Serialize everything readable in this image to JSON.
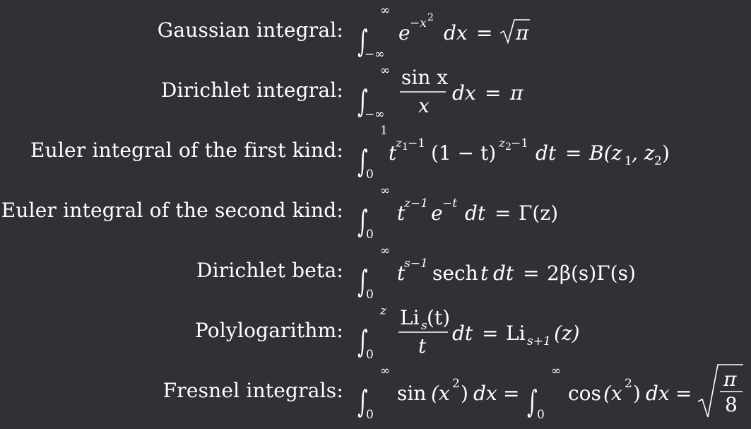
{
  "rows": [
    {
      "label": "Gaussian integral:",
      "formula": {
        "lower": "−∞",
        "upper": "∞",
        "base": "e",
        "sup": "−x",
        "supsup": "2",
        "d": "dx",
        "eq": "=",
        "root_arg": "π"
      }
    },
    {
      "label": "Dirichlet integral:",
      "formula": {
        "lower": "−∞",
        "upper": "∞",
        "numer": "sin x",
        "denom": "x",
        "d": "dx",
        "eq": "=",
        "rhs": "π"
      }
    },
    {
      "label": "Euler integral of the first kind:",
      "formula": {
        "lower": "0",
        "upper": "1",
        "t1": "t",
        "e1": "z",
        "e1s": "1",
        "e1r": "−1",
        "mid": "(1 − t)",
        "e2": "z",
        "e2s": "2",
        "e2r": "−1",
        "d": "dt",
        "eq": "=",
        "rhs": "B(z",
        "rhs_s1": "1",
        "rhs_mid": ", z",
        "rhs_s2": "2",
        "rhs_end": ")"
      }
    },
    {
      "label": "Euler integral of the second kind:",
      "formula": {
        "lower": "0",
        "upper": "∞",
        "t1": "t",
        "e1": "z−1",
        "e": "e",
        "e2": "−t",
        "d": "dt",
        "eq": "=",
        "rhs": "Γ(z)"
      }
    },
    {
      "label": "Dirichlet beta:",
      "formula": {
        "lower": "0",
        "upper": "∞",
        "t1": "t",
        "e1": "s−1",
        "sech": "sech",
        "t2": "t",
        "d": "dt",
        "eq": "=",
        "rhs": "2β(s)Γ(s)"
      }
    },
    {
      "label": "Polylogarithm:",
      "formula": {
        "lower": "0",
        "upper": "z",
        "numer_li": "Li",
        "numer_sub": "s",
        "numer_arg": "(t)",
        "denom": "t",
        "d": "dt",
        "eq": "=",
        "rhs_li": "Li",
        "rhs_sub": "s+1",
        "rhs_arg": "(z)"
      }
    },
    {
      "label": "Fresnel integrals:",
      "formula": {
        "lower": "0",
        "upper": "∞",
        "f1": "sin",
        "f2": "cos",
        "argx": "(x",
        "argsup": "2",
        "argend": ")",
        "d": "dx",
        "eq": "=",
        "root_num": "π",
        "root_den": "8"
      }
    }
  ]
}
